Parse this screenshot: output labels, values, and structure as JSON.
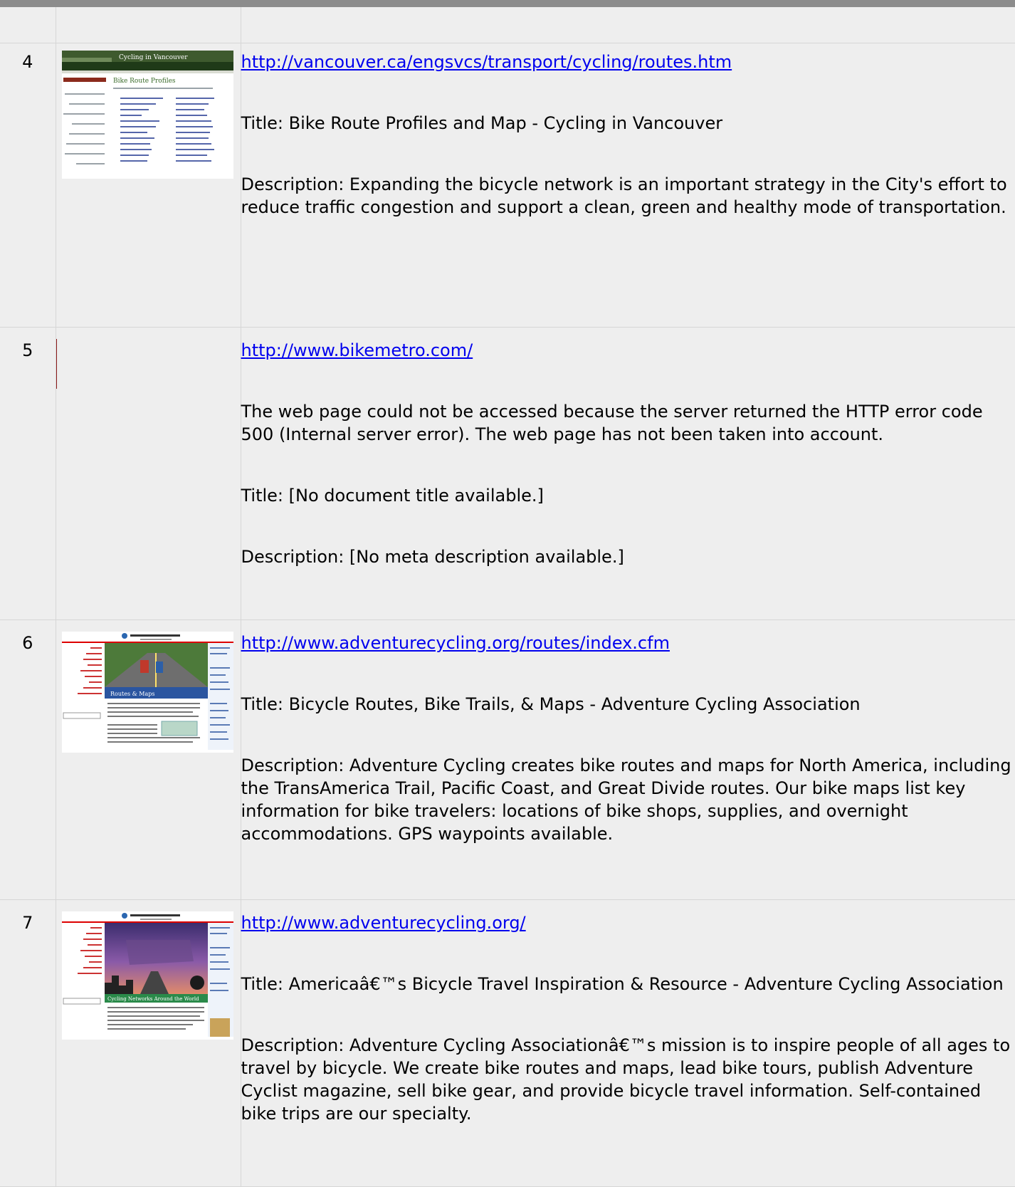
{
  "rows": [
    {
      "index": "4",
      "url": "http://vancouver.ca/engsvcs/transport/cycling/routes.htm",
      "paragraphs": [
        "Title: Bike Route Profiles and Map - Cycling in Vancouver",
        "Description: Expanding the bicycle network is an important strategy in the City's effort to reduce traffic congestion and support a clean, green and healthy mode of transportation."
      ],
      "thumbnail": "vancouver-cycling-thumbnail"
    },
    {
      "index": "5",
      "url": "http://www.bikemetro.com/",
      "paragraphs": [
        "The web page could not be accessed because the server returned the HTTP error code 500 (Internal server error). The web page has not been taken into account.",
        "Title: [No document title available.]",
        "Description: [No meta description available.]"
      ],
      "thumbnail": null
    },
    {
      "index": "6",
      "url": "http://www.adventurecycling.org/routes/index.cfm",
      "paragraphs": [
        "Title: Bicycle Routes, Bike Trails, & Maps - Adventure Cycling Association",
        "Description: Adventure Cycling creates bike routes and maps for North America, including the TransAmerica Trail, Pacific Coast, and Great Divide routes. Our bike maps list key information for bike travelers: locations of bike shops, supplies, and overnight accommodations. GPS waypoints available."
      ],
      "thumbnail": "adventure-cycling-routes-thumbnail"
    },
    {
      "index": "7",
      "url": "http://www.adventurecycling.org/",
      "paragraphs": [
        "Title: Americaâ€™s Bicycle Travel Inspiration & Resource - Adventure Cycling Association",
        "Description: Adventure Cycling Associationâ€™s mission is to inspire people of all ages to travel by bicycle. We create bike routes and maps, lead bike tours, publish Adventure Cyclist magazine, sell bike gear, and provide bicycle travel information. Self-contained bike trips are our specialty."
      ],
      "thumbnail": "adventure-cycling-home-thumbnail"
    }
  ],
  "colors": {
    "link": "#0000ee",
    "cell_background": "#eeeeee",
    "header_bar": "#8c8c8c"
  }
}
